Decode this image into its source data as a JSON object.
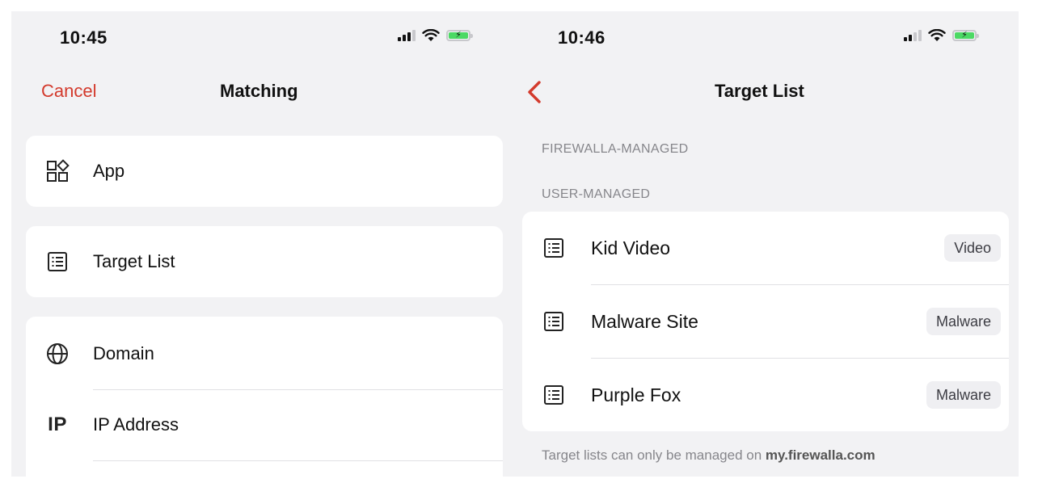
{
  "left_screen": {
    "status": {
      "time": "10:45"
    },
    "nav": {
      "cancel_label": "Cancel",
      "title": "Matching"
    },
    "options": [
      {
        "label": "App",
        "icon": "apps-icon"
      },
      {
        "label": "Target List",
        "icon": "list-icon"
      },
      {
        "label": "Domain",
        "icon": "globe-icon"
      },
      {
        "label": "IP Address",
        "icon": "ip-icon",
        "glyph": "IP"
      }
    ]
  },
  "right_screen": {
    "status": {
      "time": "10:46"
    },
    "nav": {
      "title": "Target List",
      "back_icon": "chevron-left-icon"
    },
    "sections": {
      "firewalla_managed": "FIREWALLA-MANAGED",
      "user_managed": "USER-MANAGED"
    },
    "lists": [
      {
        "name": "Kid Video",
        "tag": "Video"
      },
      {
        "name": "Malware Site",
        "tag": "Malware"
      },
      {
        "name": "Purple Fox",
        "tag": "Malware"
      }
    ],
    "footer": {
      "text": "Target lists can only be managed on ",
      "link": "my.firewalla.com"
    }
  },
  "colors": {
    "accent": "#d33a2c",
    "background": "#f2f2f4",
    "card": "#ffffff",
    "secondary_text": "#86868b"
  }
}
